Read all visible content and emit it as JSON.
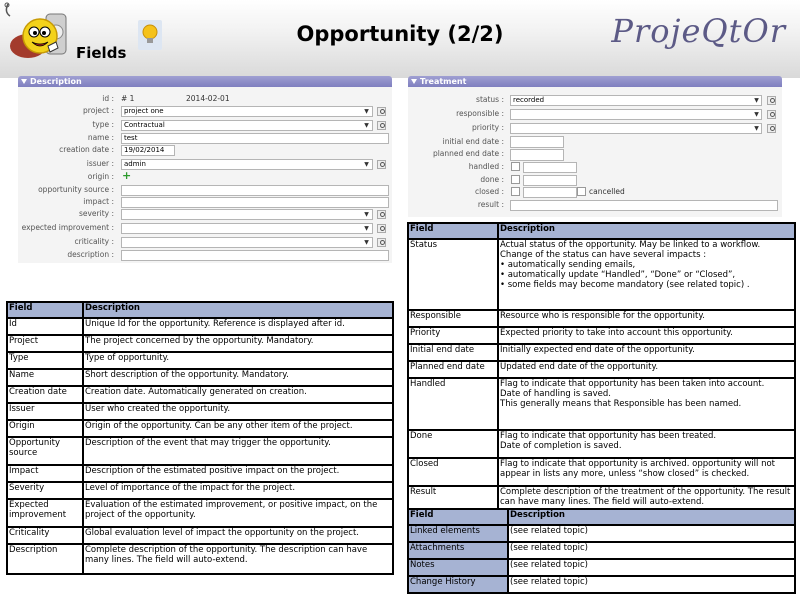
{
  "header": {
    "page_title": "Opportunity (2/2)",
    "section_label": "Fields",
    "brand": "ProjeQtOr"
  },
  "description_section": {
    "title": "Description",
    "id_label": "id :",
    "id_value": "# 1",
    "date_value": "2014-02-01",
    "project_label": "project :",
    "project_value": "project one",
    "type_label": "type :",
    "type_value": "Contractual",
    "name_label": "name :",
    "name_value": "test",
    "creation_date_label": "creation date :",
    "creation_date_value": "19/02/2014",
    "issuer_label": "issuer :",
    "issuer_value": "admin",
    "origin_label": "origin :",
    "opportunity_source_label": "opportunity source :",
    "impact_label": "impact :",
    "severity_label": "severity :",
    "expected_improvement_label": "expected improvement :",
    "criticality_label": "criticality :",
    "description_label": "description :"
  },
  "treatment_section": {
    "title": "Treatment",
    "status_label": "status :",
    "status_value": "recorded",
    "responsible_label": "responsible :",
    "priority_label": "priority :",
    "initial_end_date_label": "initial end date :",
    "planned_end_date_label": "planned end date :",
    "handled_label": "handled :",
    "done_label": "done :",
    "closed_label": "closed :",
    "cancelled_label": "cancelled",
    "result_label": "result :"
  },
  "left_table": {
    "headers": [
      "Field",
      "Description"
    ],
    "rows": [
      [
        "Id",
        "Unique Id for the opportunity. Reference is displayed after id."
      ],
      [
        "Project",
        "The project concerned by the opportunity. Mandatory."
      ],
      [
        "Type",
        "Type of opportunity."
      ],
      [
        "Name",
        "Short description of the opportunity. Mandatory."
      ],
      [
        "Creation date",
        "Creation date. Automatically generated on creation."
      ],
      [
        "Issuer",
        "User who created the opportunity."
      ],
      [
        "Origin",
        "Origin of the opportunity. Can be any other item of the project."
      ],
      [
        "Opportunity source",
        "Description of the event that may trigger the opportunity."
      ],
      [
        "Impact",
        "Description of the estimated positive impact on the project."
      ],
      [
        "Severity",
        "Level of importance of the impact for the project."
      ],
      [
        "Expected improvement",
        "Evaluation of the estimated improvement, or positive impact, on the project of the opportunity."
      ],
      [
        "Criticality",
        "Global evaluation level of impact the opportunity on the project."
      ],
      [
        "Description",
        "Complete description of the opportunity. The description can have many lines. The field will auto-extend."
      ]
    ]
  },
  "right_table": {
    "headers": [
      "Field",
      "Description"
    ],
    "status_field": "Status",
    "status_lines": [
      "Actual status of the opportunity. May be linked to a workflow.",
      "Change of the status can have several impacts :"
    ],
    "status_bullets": [
      "automatically sending emails,",
      "automatically update “Handled”, “Done” or “Closed”,",
      "some fields may become mandatory (see related topic) ."
    ],
    "rows": [
      [
        "Responsible",
        "Resource who is responsible for the opportunity."
      ],
      [
        "Priority",
        "Expected priority to take into account this opportunity."
      ],
      [
        "Initial end date",
        "Initially expected end date of the opportunity."
      ],
      [
        "Planned end date",
        "Updated end date of the opportunity."
      ]
    ],
    "handled_field": "Handled",
    "handled_lines": [
      "Flag to indicate that opportunity has been taken into account.",
      "Date of handling is saved.",
      "This generally means that Responsible has been named."
    ],
    "done_field": "Done",
    "done_lines": [
      "Flag to indicate that opportunity has been treated.",
      "Date of completion is saved."
    ],
    "closed_field": "Closed",
    "closed_desc": "Flag to indicate that opportunity is archived. opportunity will not appear in lists any more, unless “show closed” is checked.",
    "result_field": "Result",
    "result_desc": "Complete description of the treatment of the opportunity. The result can have many lines. The field will auto-extend."
  },
  "bottom_table": {
    "headers": [
      "Field",
      "Description"
    ],
    "rows": [
      [
        "Linked elements",
        "(see related topic)"
      ],
      [
        "Attachments",
        "(see related topic)"
      ],
      [
        "Notes",
        "(see related topic)"
      ],
      [
        "Change History",
        "(see related topic)"
      ]
    ]
  }
}
